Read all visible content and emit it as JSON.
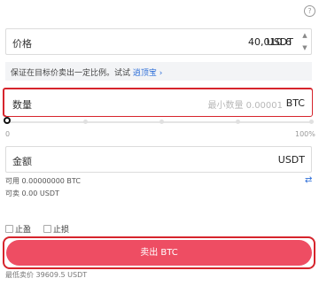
{
  "header": {
    "help_icon": "help-circle-icon",
    "help_glyph": "?"
  },
  "price_field": {
    "label": "价格",
    "value": "40,010.6",
    "unit": "USDT"
  },
  "tip": {
    "text": "保证在目标价卖出一定比例。试试",
    "link": "逍顶宝",
    "arrow": "›"
  },
  "quantity_field": {
    "label": "数量",
    "placeholder": "最小数量 0.00001",
    "unit": "BTC"
  },
  "slider": {
    "min_label": "0",
    "max_label": "100%",
    "value_fraction": 0
  },
  "amount_field": {
    "label": "金额",
    "unit": "USDT"
  },
  "balances": {
    "available": "可用 0.00000000 BTC",
    "sellable": "可卖 0.00 USDT"
  },
  "options": {
    "take_profit": "止盈",
    "stop_loss": "止损"
  },
  "sell_button": {
    "label": "卖出 BTC"
  },
  "footer": {
    "min_sell_price": "最低卖价 39609.5 USDT"
  },
  "colors": {
    "sell": "#ee4d63",
    "highlight": "#d6242c",
    "link": "#2f6fd8"
  }
}
